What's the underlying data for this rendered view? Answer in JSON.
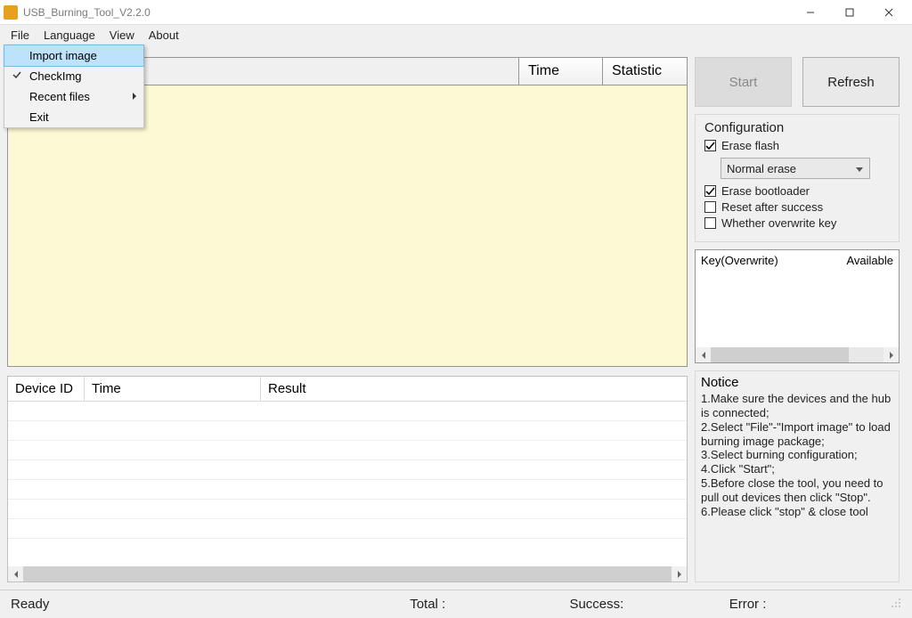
{
  "window": {
    "title": "USB_Burning_Tool_V2.2.0"
  },
  "menubar": [
    "File",
    "Language",
    "View",
    "About"
  ],
  "fileMenu": {
    "importImage": "Import image",
    "checkImg": "CheckImg",
    "recentFiles": "Recent files",
    "exit": "Exit"
  },
  "topGrid": {
    "timeHeader": "Time",
    "statHeader": "Statistic"
  },
  "devGrid": {
    "col1": "Device ID",
    "col2": "Time",
    "col3": "Result"
  },
  "buttons": {
    "start": "Start",
    "refresh": "Refresh"
  },
  "config": {
    "title": "Configuration",
    "eraseFlash": "Erase flash",
    "eraseMode": "Normal erase",
    "eraseBootloader": "Erase bootloader",
    "resetAfter": "Reset after success",
    "overwriteKey": "Whether overwrite key"
  },
  "keyBox": {
    "col1": "Key(Overwrite)",
    "col2": "Available"
  },
  "notice": {
    "title": "Notice",
    "lines": [
      "1.Make sure the devices and the hub is connected;",
      "2.Select \"File\"-\"Import image\" to load burning image package;",
      "3.Select burning configuration;",
      "4.Click \"Start\";",
      "5.Before close the tool, you need to pull out devices then click \"Stop\".",
      "6.Please click \"stop\" & close tool"
    ]
  },
  "statusbar": {
    "ready": "Ready",
    "total": "Total :",
    "success": "Success:",
    "error": "Error :"
  }
}
